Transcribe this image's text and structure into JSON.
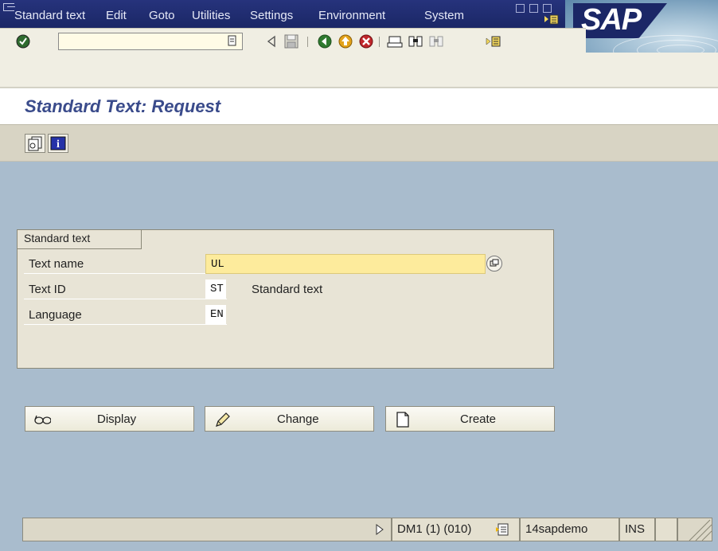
{
  "menubar": {
    "items": [
      {
        "label": "Standard text"
      },
      {
        "label": "Edit"
      },
      {
        "label": "Goto"
      },
      {
        "label": "Utilities"
      },
      {
        "label": "Settings"
      },
      {
        "label": "Environment"
      },
      {
        "label": "System"
      }
    ],
    "logo_text": "SAP"
  },
  "toolbar": {
    "command_field_value": ""
  },
  "page": {
    "title": "Standard Text: Request"
  },
  "groupbox": {
    "title": "Standard text",
    "fields": [
      {
        "label": "Text name",
        "value": "UL"
      },
      {
        "label": "Text ID",
        "value": "ST",
        "description": "Standard text"
      },
      {
        "label": "Language",
        "value": "EN"
      }
    ]
  },
  "actions": {
    "display_label": "Display",
    "change_label": "Change",
    "create_label": "Create"
  },
  "statusbar": {
    "system": "DM1 (1) (010)",
    "server": "14sapdemo",
    "mode": "INS"
  },
  "colors": {
    "title_bar": "#1b2766",
    "page_title": "#3a4b8b",
    "background": "#a9bccd",
    "required_field": "#fdeb9c"
  }
}
